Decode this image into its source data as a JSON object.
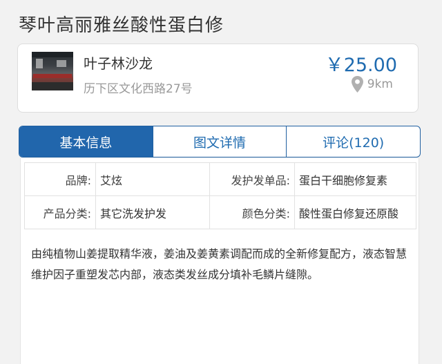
{
  "page": {
    "title": "琴叶高丽雅丝酸性蛋白修"
  },
  "shop": {
    "name": "叶子林沙龙",
    "address": "历下区文化西路27号",
    "price": "￥25.00",
    "distance": "9km",
    "thumbnail_icon": "salon-photo"
  },
  "tabs": [
    {
      "label": "基本信息",
      "active": true
    },
    {
      "label": "图文详情",
      "active": false
    },
    {
      "label": "评论(120)",
      "active": false
    }
  ],
  "attributes": {
    "row1": {
      "label_a": "品牌:",
      "value_a": "艾炫",
      "label_b": "发护发单品:",
      "value_b": "蛋白干细胞修复素"
    },
    "row2": {
      "label_a": "产品分类:",
      "value_a": "其它洗发护发",
      "label_b": "颜色分类:",
      "value_b": "酸性蛋白修复还原酸"
    }
  },
  "description": "由纯植物山姜提取精华液，姜油及姜黄素调配而成的全新修复配方，液态智慧维护因子重塑发芯内部，液态类发丝成分填补毛鳞片缝隙。",
  "colors": {
    "accent": "#2166ac",
    "price": "#1f6bb0",
    "muted": "#999999"
  }
}
